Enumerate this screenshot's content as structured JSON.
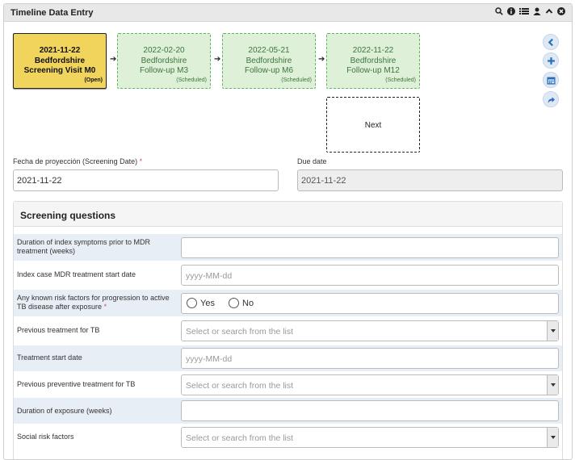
{
  "window": {
    "title": "Timeline Data Entry",
    "icons": [
      "search-icon",
      "info-icon",
      "list-icon",
      "user-icon",
      "chevron-up-icon",
      "close-icon"
    ]
  },
  "timeline": {
    "visits": [
      {
        "date": "2021-11-22",
        "site": "Bedfordshire",
        "name": "Screening Visit M0",
        "status": "(Open)"
      },
      {
        "date": "2022-02-20",
        "site": "Bedfordshire",
        "name": "Follow-up M3",
        "status": "(Scheduled)"
      },
      {
        "date": "2022-05-21",
        "site": "Bedfordshire",
        "name": "Follow-up M6",
        "status": "(Scheduled)"
      },
      {
        "date": "2022-11-22",
        "site": "Bedfordshire",
        "name": "Follow-up M12",
        "status": "(Scheduled)"
      }
    ],
    "next_label": "Next",
    "arrow": "➔",
    "side_icons": [
      "chevron-left-icon",
      "plus-icon",
      "calendar-icon",
      "share-icon"
    ]
  },
  "dates": {
    "screening_label": "Fecha de proyección (Screening Date)",
    "required_mark": "*",
    "screening_value": "2021-11-22",
    "due_label": "Due date",
    "due_value": "2021-11-22"
  },
  "section": {
    "title": "Screening questions",
    "questions": [
      {
        "label": "Duration of index symptoms prior to MDR treatment (weeks)",
        "value": ""
      },
      {
        "label": "Index case MDR treatment start date",
        "placeholder": "yyyy-MM-dd"
      },
      {
        "label": "Any known risk factors for progression to active TB disease after exposure",
        "required": "*",
        "yes": "Yes",
        "no": "No"
      },
      {
        "label": "Previous treatment for TB",
        "placeholder": "Select or search from the list"
      },
      {
        "label": "Treatment start date",
        "placeholder": "yyyy-MM-dd"
      },
      {
        "label": "Previous preventive treatment for TB",
        "placeholder": "Select or search from the list"
      },
      {
        "label": "Duration of exposure (weeks)",
        "value": ""
      },
      {
        "label": "Social risk factors",
        "placeholder": "Select or search from the list"
      }
    ]
  }
}
